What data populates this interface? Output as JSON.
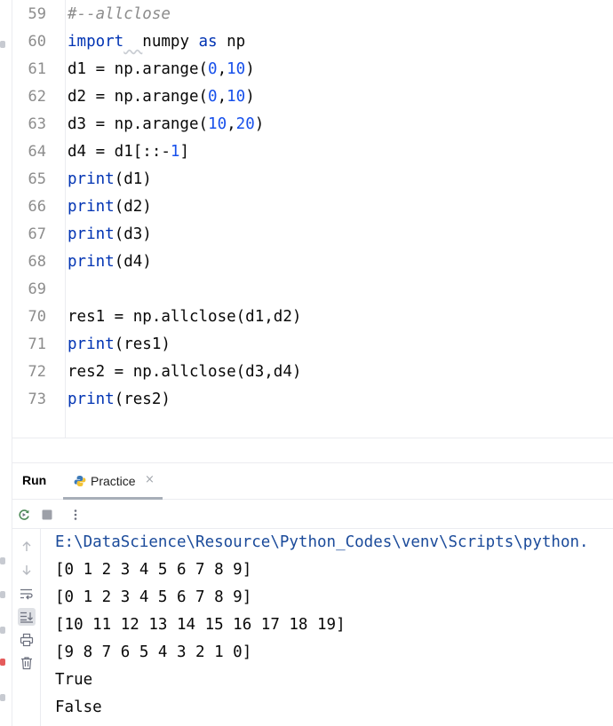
{
  "editor": {
    "lines": [
      {
        "n": "59",
        "tokens": [
          {
            "t": "#--allclose",
            "c": "cmt"
          }
        ]
      },
      {
        "n": "60",
        "tokens": [
          {
            "t": "import",
            "c": "kw"
          },
          {
            "t": "  ",
            "c": "wavy"
          },
          {
            "t": "numpy ",
            "c": ""
          },
          {
            "t": "as",
            "c": "kw"
          },
          {
            "t": " np",
            "c": ""
          }
        ]
      },
      {
        "n": "61",
        "tokens": [
          {
            "t": "d1 = np.arange(",
            "c": ""
          },
          {
            "t": "0",
            "c": "num"
          },
          {
            "t": ",",
            "c": ""
          },
          {
            "t": "10",
            "c": "num"
          },
          {
            "t": ")",
            "c": ""
          }
        ]
      },
      {
        "n": "62",
        "tokens": [
          {
            "t": "d2 = np.arange(",
            "c": ""
          },
          {
            "t": "0",
            "c": "num"
          },
          {
            "t": ",",
            "c": ""
          },
          {
            "t": "10",
            "c": "num"
          },
          {
            "t": ")",
            "c": ""
          }
        ]
      },
      {
        "n": "63",
        "tokens": [
          {
            "t": "d3 = np.arange(",
            "c": ""
          },
          {
            "t": "10",
            "c": "num"
          },
          {
            "t": ",",
            "c": ""
          },
          {
            "t": "20",
            "c": "num"
          },
          {
            "t": ")",
            "c": ""
          }
        ]
      },
      {
        "n": "64",
        "tokens": [
          {
            "t": "d4 = d1[::-",
            "c": ""
          },
          {
            "t": "1",
            "c": "num"
          },
          {
            "t": "]",
            "c": ""
          }
        ]
      },
      {
        "n": "65",
        "tokens": [
          {
            "t": "print",
            "c": "kw"
          },
          {
            "t": "(d1)",
            "c": ""
          }
        ]
      },
      {
        "n": "66",
        "tokens": [
          {
            "t": "print",
            "c": "kw"
          },
          {
            "t": "(d2)",
            "c": ""
          }
        ]
      },
      {
        "n": "67",
        "tokens": [
          {
            "t": "print",
            "c": "kw"
          },
          {
            "t": "(d3)",
            "c": ""
          }
        ]
      },
      {
        "n": "68",
        "tokens": [
          {
            "t": "print",
            "c": "kw"
          },
          {
            "t": "(d4)",
            "c": ""
          }
        ]
      },
      {
        "n": "69",
        "tokens": []
      },
      {
        "n": "70",
        "tokens": [
          {
            "t": "res1 = np.allclose(d1,d2)",
            "c": ""
          }
        ]
      },
      {
        "n": "71",
        "tokens": [
          {
            "t": "print",
            "c": "kw"
          },
          {
            "t": "(res1)",
            "c": ""
          }
        ]
      },
      {
        "n": "72",
        "tokens": [
          {
            "t": "res2 = np.allclose(d3,d4)",
            "c": ""
          }
        ]
      },
      {
        "n": "73",
        "tokens": [
          {
            "t": "print",
            "c": "kw"
          },
          {
            "t": "(res2)",
            "c": ""
          }
        ]
      }
    ]
  },
  "run_panel": {
    "title": "Run",
    "tab_label": "Practice",
    "tab_close": "×",
    "tab_icon": "python-icon",
    "toolbar_icons": [
      "rerun-icon",
      "stop-icon",
      "more-options-icon"
    ],
    "side_icons": [
      "arrow-up-icon",
      "arrow-down-icon",
      "soft-wrap-icon",
      "scroll-to-end-icon",
      "print-icon",
      "trash-icon"
    ],
    "selected_side_icon": "scroll-to-end-icon"
  },
  "console": {
    "lines": [
      "E:\\DataScience\\Resource\\Python_Codes\\venv\\Scripts\\python.",
      "[0 1 2 3 4 5 6 7 8 9]",
      "[0 1 2 3 4 5 6 7 8 9]",
      "[10 11 12 13 14 15 16 17 18 19]",
      "[9 8 7 6 5 4 3 2 1 0]",
      "True",
      "False"
    ]
  },
  "colors": {
    "keyword": "#0033b3",
    "number": "#1750eb",
    "comment": "#8c8c8c",
    "text": "#080808",
    "path": "#1a4a9a"
  }
}
